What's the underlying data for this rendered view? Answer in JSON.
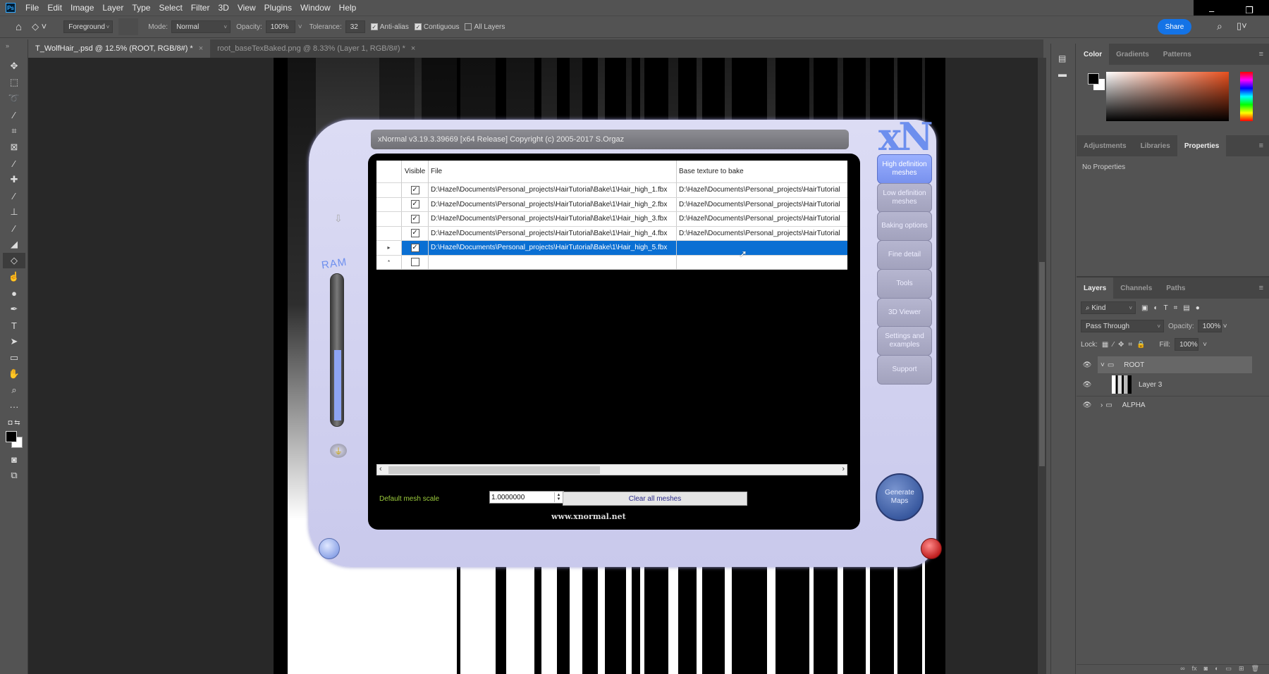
{
  "app": {
    "logo": "Ps"
  },
  "menu": [
    "File",
    "Edit",
    "Image",
    "Layer",
    "Type",
    "Select",
    "Filter",
    "3D",
    "View",
    "Plugins",
    "Window",
    "Help"
  ],
  "window_controls": {
    "minimize": "–",
    "restore": "❐"
  },
  "options_bar": {
    "fill_source": "Foreground",
    "mode_label": "Mode:",
    "mode_value": "Normal",
    "opacity_label": "Opacity:",
    "opacity_value": "100%",
    "tolerance_label": "Tolerance:",
    "tolerance_value": "32",
    "anti_alias": {
      "label": "Anti-alias",
      "checked": true
    },
    "contiguous": {
      "label": "Contiguous",
      "checked": true
    },
    "all_layers": {
      "label": "All Layers",
      "checked": false
    },
    "share_label": "Share"
  },
  "doc_tabs": [
    {
      "label": "T_WolfHair_.psd @ 12.5% (ROOT, RGB/8#) *",
      "active": true
    },
    {
      "label": "root_baseTexBaked.png @ 8.33% (Layer 1, RGB/8#) *",
      "active": false
    }
  ],
  "tools": [
    "move-tool",
    "marquee-tool",
    "lasso-tool",
    "magic-wand-tool",
    "crop-tool",
    "frame-tool",
    "eyedropper-tool",
    "healing-tool",
    "brush-tool",
    "stamp-tool",
    "history-brush-tool",
    "eraser-tool",
    "paint-bucket-tool",
    "smudge-tool",
    "dodge-tool",
    "pen-tool",
    "type-tool",
    "path-selection-tool",
    "rectangle-tool",
    "hand-tool",
    "zoom-tool",
    "more-tools"
  ],
  "xnormal": {
    "title": "xNormal v3.19.3.39669 [x64 Release] Copyright (c) 2005-2017 S.Orgaz",
    "logo": "xN",
    "ram_label": "RAM",
    "ram_usage": 0.5,
    "columns": [
      "",
      "Visible",
      "File",
      "Base texture to bake"
    ],
    "rows": [
      {
        "marker": "",
        "visible": true,
        "file": "D:\\Hazel\\Documents\\Personal_projects\\HairTutorial\\Bake\\1\\Hair_high_1.fbx",
        "base": "D:\\Hazel\\Documents\\Personal_projects\\HairTutorial"
      },
      {
        "marker": "",
        "visible": true,
        "file": "D:\\Hazel\\Documents\\Personal_projects\\HairTutorial\\Bake\\1\\Hair_high_2.fbx",
        "base": "D:\\Hazel\\Documents\\Personal_projects\\HairTutorial"
      },
      {
        "marker": "",
        "visible": true,
        "file": "D:\\Hazel\\Documents\\Personal_projects\\HairTutorial\\Bake\\1\\Hair_high_3.fbx",
        "base": "D:\\Hazel\\Documents\\Personal_projects\\HairTutorial"
      },
      {
        "marker": "",
        "visible": true,
        "file": "D:\\Hazel\\Documents\\Personal_projects\\HairTutorial\\Bake\\1\\Hair_high_4.fbx",
        "base": "D:\\Hazel\\Documents\\Personal_projects\\HairTutorial"
      },
      {
        "marker": "▸",
        "visible": true,
        "file": "D:\\Hazel\\Documents\\Personal_projects\\HairTutorial\\Bake\\1\\Hair_high_5.fbx",
        "base": "",
        "selected": true
      },
      {
        "marker": "*",
        "visible": false,
        "file": "",
        "base": ""
      }
    ],
    "mesh_scale_label": "Default mesh scale",
    "mesh_scale_value": "1.0000000",
    "clear_label": "Clear all meshes",
    "url": "www.xnormal.net",
    "nav_buttons": [
      {
        "label": "High definition meshes",
        "active": true
      },
      {
        "label": "Low definition meshes",
        "active": false
      },
      {
        "label": "Baking options",
        "active": false
      },
      {
        "label": "Fine detail",
        "active": false
      },
      {
        "label": "Tools",
        "active": false
      },
      {
        "label": "3D Viewer",
        "active": false
      },
      {
        "label": "Settings and examples",
        "active": false
      },
      {
        "label": "Support",
        "active": false
      }
    ],
    "generate_label": "Generate Maps"
  },
  "panels": {
    "color_tabs": [
      "Color",
      "Gradients",
      "Patterns"
    ],
    "props_tabs": [
      "Adjustments",
      "Libraries",
      "Properties"
    ],
    "props_text": "No Properties",
    "layers_tabs": [
      "Layers",
      "Channels",
      "Paths"
    ],
    "filter_kind": "Kind",
    "blend_mode": "Pass Through",
    "opacity_label": "Opacity:",
    "opacity_value": "100%",
    "lock_label": "Lock:",
    "fill_label": "Fill:",
    "fill_value": "100%",
    "layers": [
      {
        "name": "ROOT",
        "type": "group",
        "expanded": true,
        "selected": true,
        "visible": true
      },
      {
        "name": "Layer 3",
        "type": "layer",
        "visible": true
      },
      {
        "name": "ALPHA",
        "type": "group",
        "expanded": false,
        "visible": true
      }
    ]
  },
  "colors": {
    "accent": "#1473e6",
    "xn_active": "#7891ee",
    "grid_selection": "#0a6fd3",
    "mesh_scale_label": "#9ccc3c"
  }
}
